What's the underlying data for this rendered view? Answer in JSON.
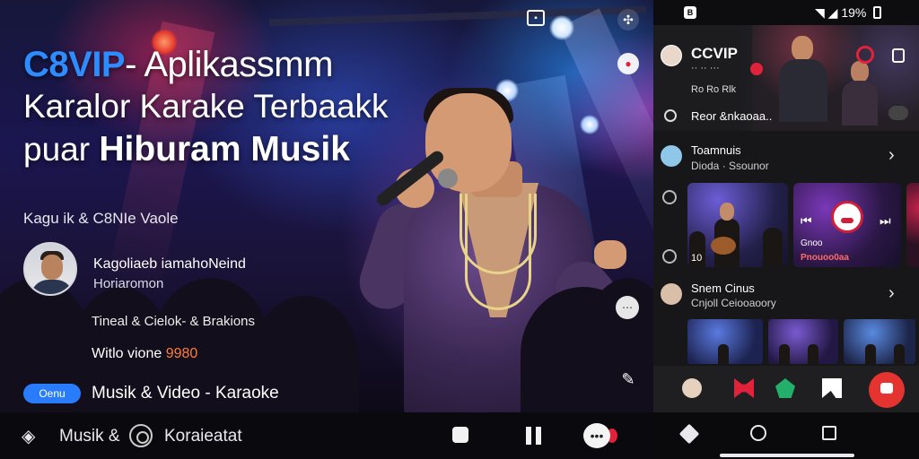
{
  "hero": {
    "title_brand": "C8VIP",
    "title_rest": "- Aplikassmm",
    "title_line2": "Karalor Karake Terbaakk",
    "title_line3_prefix": "puar",
    "title_line3_bold": "Hiburam Musik",
    "subline": "Kagu ik & C8NIe Vaole",
    "profile_name": "Kagoliaeb iamahoNeind",
    "profile_role": "Horiaromon",
    "info1": "Tineal & Cielok- & Brakions",
    "info2_prefix": "Witlo vione",
    "info2_price": "9980",
    "pill": "Oenu",
    "pill_text": "Musik & Video - Karaoke"
  },
  "bottom_bar": {
    "label1": "Musik &",
    "label2": "Koraieatat"
  },
  "phone": {
    "status": {
      "app_glyph": "B",
      "battery": "19%"
    },
    "live": {
      "title": "CCVIP",
      "sub": "·· ·· ···",
      "sub2": "Ro Ro Rlk",
      "caption": "Reor &nkaoaa.."
    },
    "section1": {
      "title": "Toamnuis",
      "sub": "Dioda · Ssounor"
    },
    "thumb1": {
      "number": "10"
    },
    "thumb2": {
      "line1": "Gnoo",
      "line2": "Pnouoo0aa"
    },
    "section2": {
      "title": "Snem Cinus",
      "sub": "Cnjoll Ceiooaoory"
    }
  },
  "icons": {
    "hero_top1": "square-icon",
    "hero_top2": "share-icon",
    "hero_pin": "pin-icon",
    "hero_more": "more-icon",
    "hero_edit": "edit-icon"
  },
  "colors": {
    "brand": "#2d8cff",
    "accent_red": "#e0233a",
    "price": "#ff7d3b",
    "pill": "#2a7cff"
  }
}
